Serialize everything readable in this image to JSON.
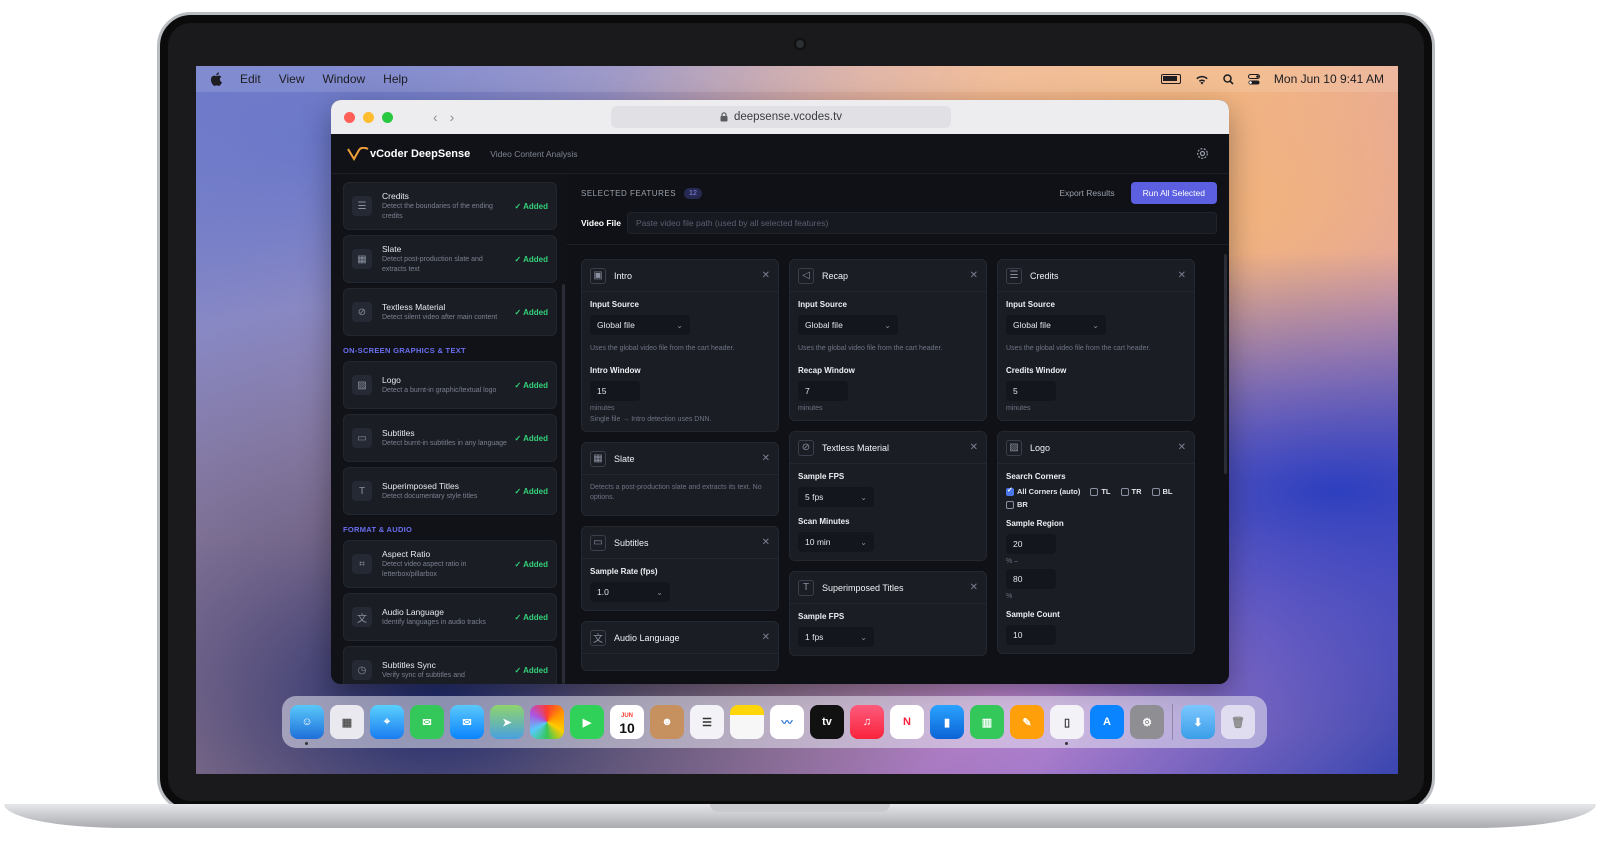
{
  "menubar": {
    "items": [
      "Edit",
      "View",
      "Window",
      "Help"
    ],
    "datetime": "Mon Jun 10  9:41 AM"
  },
  "browser": {
    "url": "deepsense.vcodes.tv"
  },
  "app": {
    "brand": "vCoder DeepSense",
    "subtitle": "Video Content Analysis"
  },
  "sidebar": {
    "items_top": [
      {
        "title": "Credits",
        "desc": "Detect the boundaries of the ending credits",
        "status": "✓ Added",
        "icon": "list-icon"
      },
      {
        "title": "Slate",
        "desc": "Detect post-production slate and extracts text",
        "status": "✓ Added",
        "icon": "calendar-icon"
      },
      {
        "title": "Textless Material",
        "desc": "Detect silent video after main content",
        "status": "✓ Added",
        "icon": "no-video-icon"
      }
    ],
    "section_graphics": "ON-SCREEN GRAPHICS & TEXT",
    "items_graphics": [
      {
        "title": "Logo",
        "desc": "Detect a burnt-in graphic/textual logo",
        "status": "✓ Added",
        "icon": "image-icon"
      },
      {
        "title": "Subtitles",
        "desc": "Detect burnt-in subtitles in any language",
        "status": "✓ Added",
        "icon": "caption-icon"
      },
      {
        "title": "Superimposed Titles",
        "desc": "Detect documentary style titles",
        "status": "✓ Added",
        "icon": "text-icon"
      }
    ],
    "section_format": "FORMAT & AUDIO",
    "items_format": [
      {
        "title": "Aspect Ratio",
        "desc": "Detect video aspect ratio in letterbox/pillarbox",
        "status": "✓ Added",
        "icon": "crop-icon"
      },
      {
        "title": "Audio Language",
        "desc": "Identify languages in audio tracks",
        "status": "✓ Added",
        "icon": "translate-icon"
      },
      {
        "title": "Subtitles Sync",
        "desc": "Verify sync of subtitles and",
        "status": "✓ Added",
        "icon": "clock-icon"
      }
    ]
  },
  "main": {
    "selected_label": "SELECTED FEATURES",
    "selected_count": "12",
    "export_label": "Export Results",
    "run_label": "Run All Selected",
    "video_file_label": "Video File",
    "video_file_placeholder": "Paste video file path (used by all selected features)"
  },
  "cards": {
    "intro": {
      "title": "Intro",
      "input_source_label": "Input Source",
      "input_source_value": "Global file",
      "hint": "Uses the global video file from the cart header.",
      "window_label": "Intro Window",
      "window_value": "15",
      "unit": "minutes",
      "note": "Single file → Intro detection uses DNN."
    },
    "recap": {
      "title": "Recap",
      "input_source_label": "Input Source",
      "input_source_value": "Global file",
      "hint": "Uses the global video file from the cart header.",
      "window_label": "Recap Window",
      "window_value": "7",
      "unit": "minutes"
    },
    "credits": {
      "title": "Credits",
      "input_source_label": "Input Source",
      "input_source_value": "Global file",
      "hint": "Uses the global video file from the cart header.",
      "window_label": "Credits Window",
      "window_value": "5",
      "unit": "minutes"
    },
    "slate": {
      "title": "Slate",
      "desc": "Detects a post-production slate and extracts its text. No options."
    },
    "textless": {
      "title": "Textless Material",
      "fps_label": "Sample FPS",
      "fps_value": "5 fps",
      "scan_label": "Scan Minutes",
      "scan_value": "10 min"
    },
    "logo": {
      "title": "Logo",
      "corners_label": "Search Corners",
      "all_corners": "All Corners (auto)",
      "tl": "TL",
      "tr": "TR",
      "bl": "BL",
      "br": "BR",
      "region_label": "Sample Region",
      "region_from": "20",
      "region_from_unit": "% –",
      "region_to": "80",
      "region_to_unit": "%",
      "count_label": "Sample Count",
      "count_value": "10"
    },
    "subtitles": {
      "title": "Subtitles",
      "rate_label": "Sample Rate (fps)",
      "rate_value": "1.0"
    },
    "superimposed": {
      "title": "Superimposed Titles",
      "fps_label": "Sample FPS",
      "fps_value": "1 fps"
    },
    "audio": {
      "title": "Audio Language"
    }
  },
  "dock": {
    "calendar_month": "JUN",
    "calendar_day": "10",
    "tv_label": "tv"
  }
}
